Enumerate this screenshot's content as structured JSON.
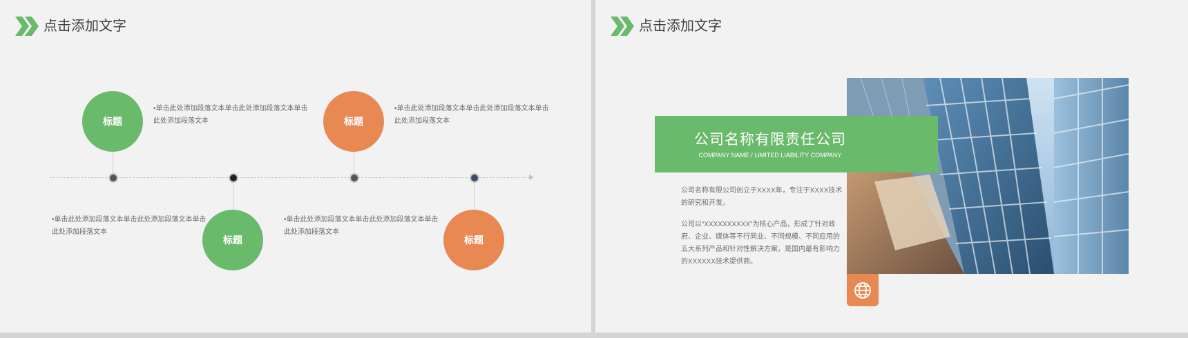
{
  "left_slide": {
    "header_title": "点击添加文字",
    "items": [
      {
        "label": "标题",
        "text": "•单击此处添加段落文本单击此处添加段落文本单击此处添加段落文本"
      },
      {
        "label": "标题",
        "text": "•单击此处添加段落文本单击此处添加段落文本单击此处添加段落文本"
      },
      {
        "label": "标题",
        "text": "•单击此处添加段落文本单击此处添加段落文本单击此处添加段落文本"
      },
      {
        "label": "标题",
        "text": "•单击此处添加段落文本单击此处添加段落文本单击此处添加段落文本"
      }
    ]
  },
  "right_slide": {
    "header_title": "点击添加文字",
    "company_name": "公司名称有限责任公司",
    "company_name_en": "COMPANY NAME / LIMITED LIABILITY COMPANY",
    "paragraph1": "公司名称有限公司创立于XXXX年，专注于XXXX技术的研究和开发。",
    "paragraph2": "公司以“XXXXXXXXXX”为核心产品，形成了针对政府、企业、媒体等不行同业、不同规模、不同应用的五大系列产品和针对性解决方案，是国内最有影响力的XXXXXX技术提供商。"
  },
  "colors": {
    "green": "#6aba6b",
    "orange": "#e88852",
    "background": "#f2f2f2"
  },
  "icons": {
    "header": "double-chevron-icon",
    "badge": "globe-icon"
  }
}
